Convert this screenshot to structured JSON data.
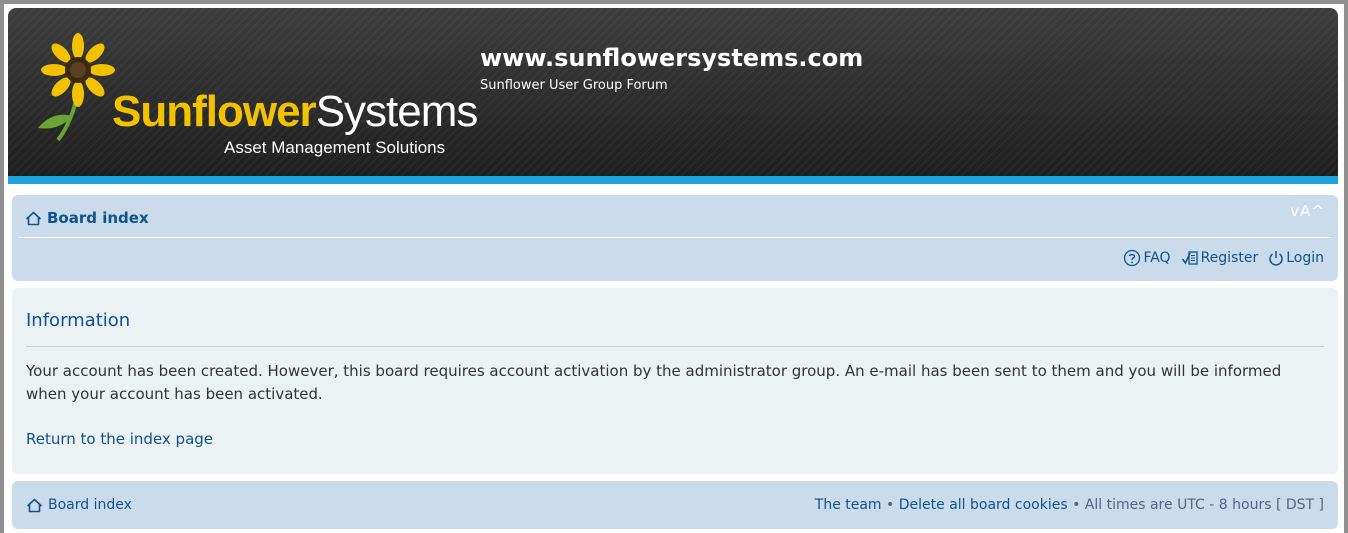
{
  "header": {
    "logo": {
      "brand_bold": "Sunflower",
      "brand_light": "Systems",
      "tagline": "Asset Management Solutions"
    },
    "site_title": "www.sunflowersystems.com",
    "site_description": "Sunflower User Group Forum"
  },
  "navbar": {
    "breadcrumb": "Board index",
    "font_size_control": "vA^",
    "links": {
      "faq": "FAQ",
      "register": "Register",
      "login": "Login"
    }
  },
  "content": {
    "title": "Information",
    "message": "Your account has been created. However, this board requires account activation by the administrator group. An e-mail has been sent to them and you will be informed when your account has been activated.",
    "return_link": "Return to the index page"
  },
  "footer": {
    "breadcrumb": "Board index",
    "team_link": "The team",
    "delete_cookies_link": "Delete all board cookies",
    "separator": "•",
    "timezone_text": "All times are UTC - 8 hours [ DST ]"
  },
  "colors": {
    "header_accent": "#1fa3e0",
    "logo_yellow": "#f2c200",
    "nav_background": "#cadceb",
    "panel_background": "#ecf1f3",
    "link": "#105289"
  },
  "icons": {
    "home": "home-icon",
    "faq": "faq-icon",
    "register": "register-icon",
    "login": "power-icon"
  }
}
